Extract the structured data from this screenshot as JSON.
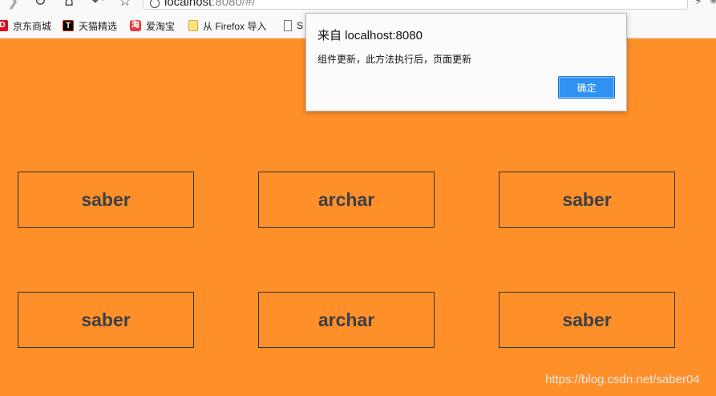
{
  "browser": {
    "url_host": "localhost",
    "url_rest": ":8080/#/",
    "icons": [
      "back-icon",
      "reload-icon",
      "home-icon",
      "undo-icon",
      "bookmark-star-icon",
      "info-icon",
      "lightning-icon"
    ]
  },
  "bookmarks": [
    {
      "label": "京东商城",
      "icon": "jd-icon",
      "glyph": "D"
    },
    {
      "label": "天猫精选",
      "icon": "tmall-icon",
      "glyph": "T"
    },
    {
      "label": "爱淘宝",
      "icon": "taobao-icon",
      "glyph": "淘"
    },
    {
      "label": "从 Firefox 导入",
      "icon": "folder-icon",
      "glyph": ""
    },
    {
      "label": "S",
      "icon": "page-icon",
      "glyph": ""
    }
  ],
  "page": {
    "background": "#ff9029",
    "cards": [
      {
        "text": "saber"
      },
      {
        "text": "archar"
      },
      {
        "text": "saber"
      },
      {
        "text": "saber"
      },
      {
        "text": "archar"
      },
      {
        "text": "saber"
      }
    ],
    "watermark": "https://blog.csdn.net/saber04"
  },
  "alert": {
    "title": "来自 localhost:8080",
    "message": "组件更新，此方法执行后，页面更新",
    "ok_label": "确定",
    "button_color": "#2f92f2"
  }
}
